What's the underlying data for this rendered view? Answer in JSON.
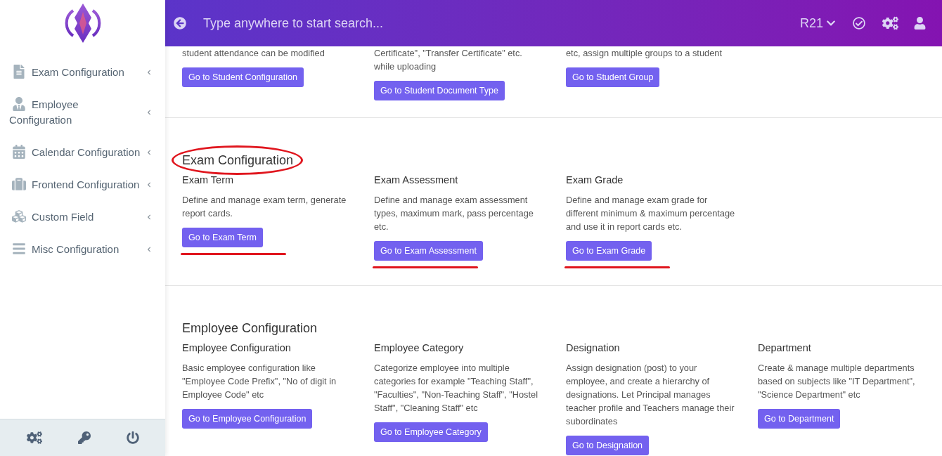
{
  "header": {
    "search_placeholder": "Type anywhere to start search...",
    "session": "R21"
  },
  "sidebar": {
    "items": [
      {
        "label": "Exam Configuration"
      },
      {
        "label": "Employee Configuration"
      },
      {
        "label": "Calendar Configuration"
      },
      {
        "label": "Frontend Configuration"
      },
      {
        "label": "Custom Field"
      },
      {
        "label": "Misc Configuration"
      }
    ]
  },
  "sections": [
    {
      "cards": [
        {
          "description": "student attendance can be modified",
          "button": "Go to Student Configuration"
        },
        {
          "description": "Certificate\", \"Transfer Certificate\" etc. while uploading",
          "button": "Go to Student Document Type"
        },
        {
          "description": "etc, assign multiple groups to a student",
          "button": "Go to Student Group"
        }
      ]
    },
    {
      "heading": "Exam Configuration",
      "highlighted": true,
      "cards": [
        {
          "title": "Exam Term",
          "description": "Define and manage exam term, generate report cards.",
          "button": "Go to Exam Term",
          "underlined": true
        },
        {
          "title": "Exam Assessment",
          "description": "Define and manage exam assessment types, maximum mark, pass percentage etc.",
          "button": "Go to Exam Assessment",
          "underlined": true
        },
        {
          "title": "Exam Grade",
          "description": "Define and manage exam grade for different minimum & maximum percentage and use it in report cards etc.",
          "button": "Go to Exam Grade",
          "underlined": true
        }
      ]
    },
    {
      "heading": "Employee Configuration",
      "cards": [
        {
          "title": "Employee Configuration",
          "description": "Basic employee configuration like \"Employee Code Prefix\", \"No of digit in Employee Code\" etc",
          "button": "Go to Employee Configuration"
        },
        {
          "title": "Employee Category",
          "description": "Categorize employee into multiple categories for example \"Teaching Staff\", \"Faculties\", \"Non-Teaching Staff\", \"Hostel Staff\", \"Cleaning Staff\" etc",
          "button": "Go to Employee Category"
        },
        {
          "title": "Designation",
          "description": "Assign designation (post) to your employee, and create a hierarchy of designations. Let Principal manages teacher profile and Teachers manage their subordinates",
          "button": "Go to Designation"
        },
        {
          "title": "Department",
          "description": "Create & manage multiple departments based on subjects like \"IT Department\", \"Science Department\" etc",
          "button": "Go to Department"
        }
      ]
    }
  ]
}
